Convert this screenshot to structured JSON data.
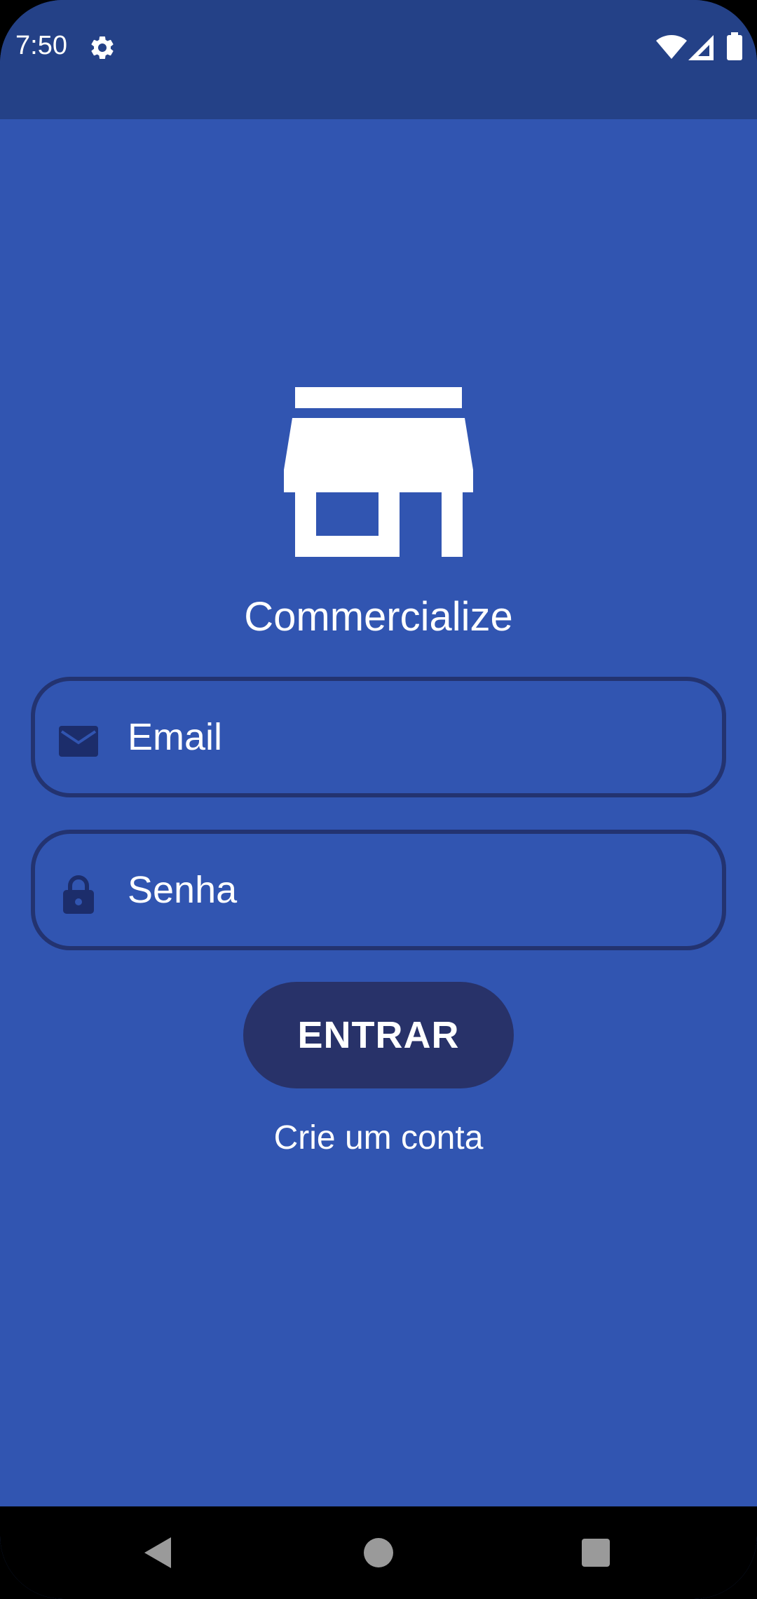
{
  "status_bar": {
    "time": "7:50",
    "icons": [
      "settings-icon",
      "wifi-icon",
      "signal-icon",
      "battery-icon"
    ]
  },
  "app": {
    "logo_icon": "store-icon",
    "title": "Commercialize"
  },
  "form": {
    "email": {
      "icon": "email-icon",
      "placeholder": "Email",
      "value": ""
    },
    "password": {
      "icon": "lock-icon",
      "placeholder": "Senha",
      "value": ""
    },
    "login_button": "ENTRAR",
    "create_account_link": "Crie um conta"
  },
  "nav_bar": {
    "buttons": [
      "back-icon",
      "home-icon",
      "recents-icon"
    ]
  },
  "colors": {
    "background": "#3155b1",
    "status_bar": "#244187",
    "field_border": "#233370",
    "button": "#283269",
    "text": "#ffffff"
  }
}
